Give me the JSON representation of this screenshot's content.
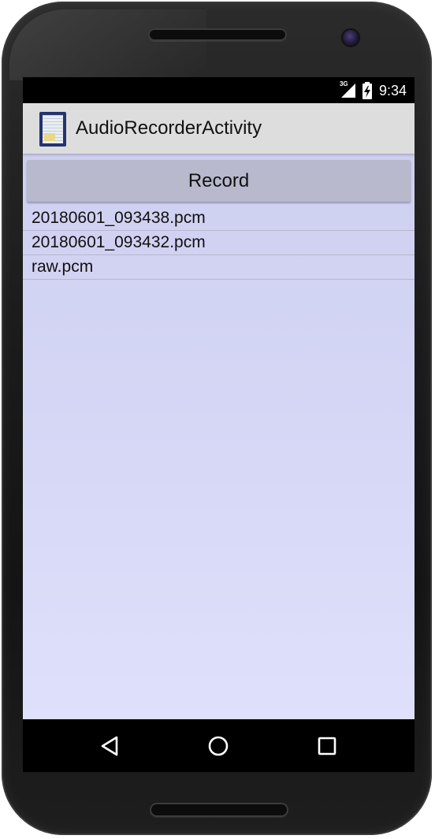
{
  "status_bar": {
    "network": "3G",
    "time": "9:34",
    "icons": [
      "signal-icon",
      "battery-charging-icon"
    ]
  },
  "action_bar": {
    "icon": "app-notebook-icon",
    "title": "AudioRecorderActivity"
  },
  "main": {
    "record_label": "Record",
    "files": [
      "20180601_093438.pcm",
      "20180601_093432.pcm",
      "raw.pcm"
    ]
  },
  "nav_bar": {
    "icons": [
      "back-icon",
      "home-icon",
      "recents-icon"
    ]
  },
  "colors": {
    "content_background": "#d4d5f5",
    "record_button": "#b8b9cc",
    "action_bar": "#dddddd",
    "bezel": "#1b1b1b"
  }
}
